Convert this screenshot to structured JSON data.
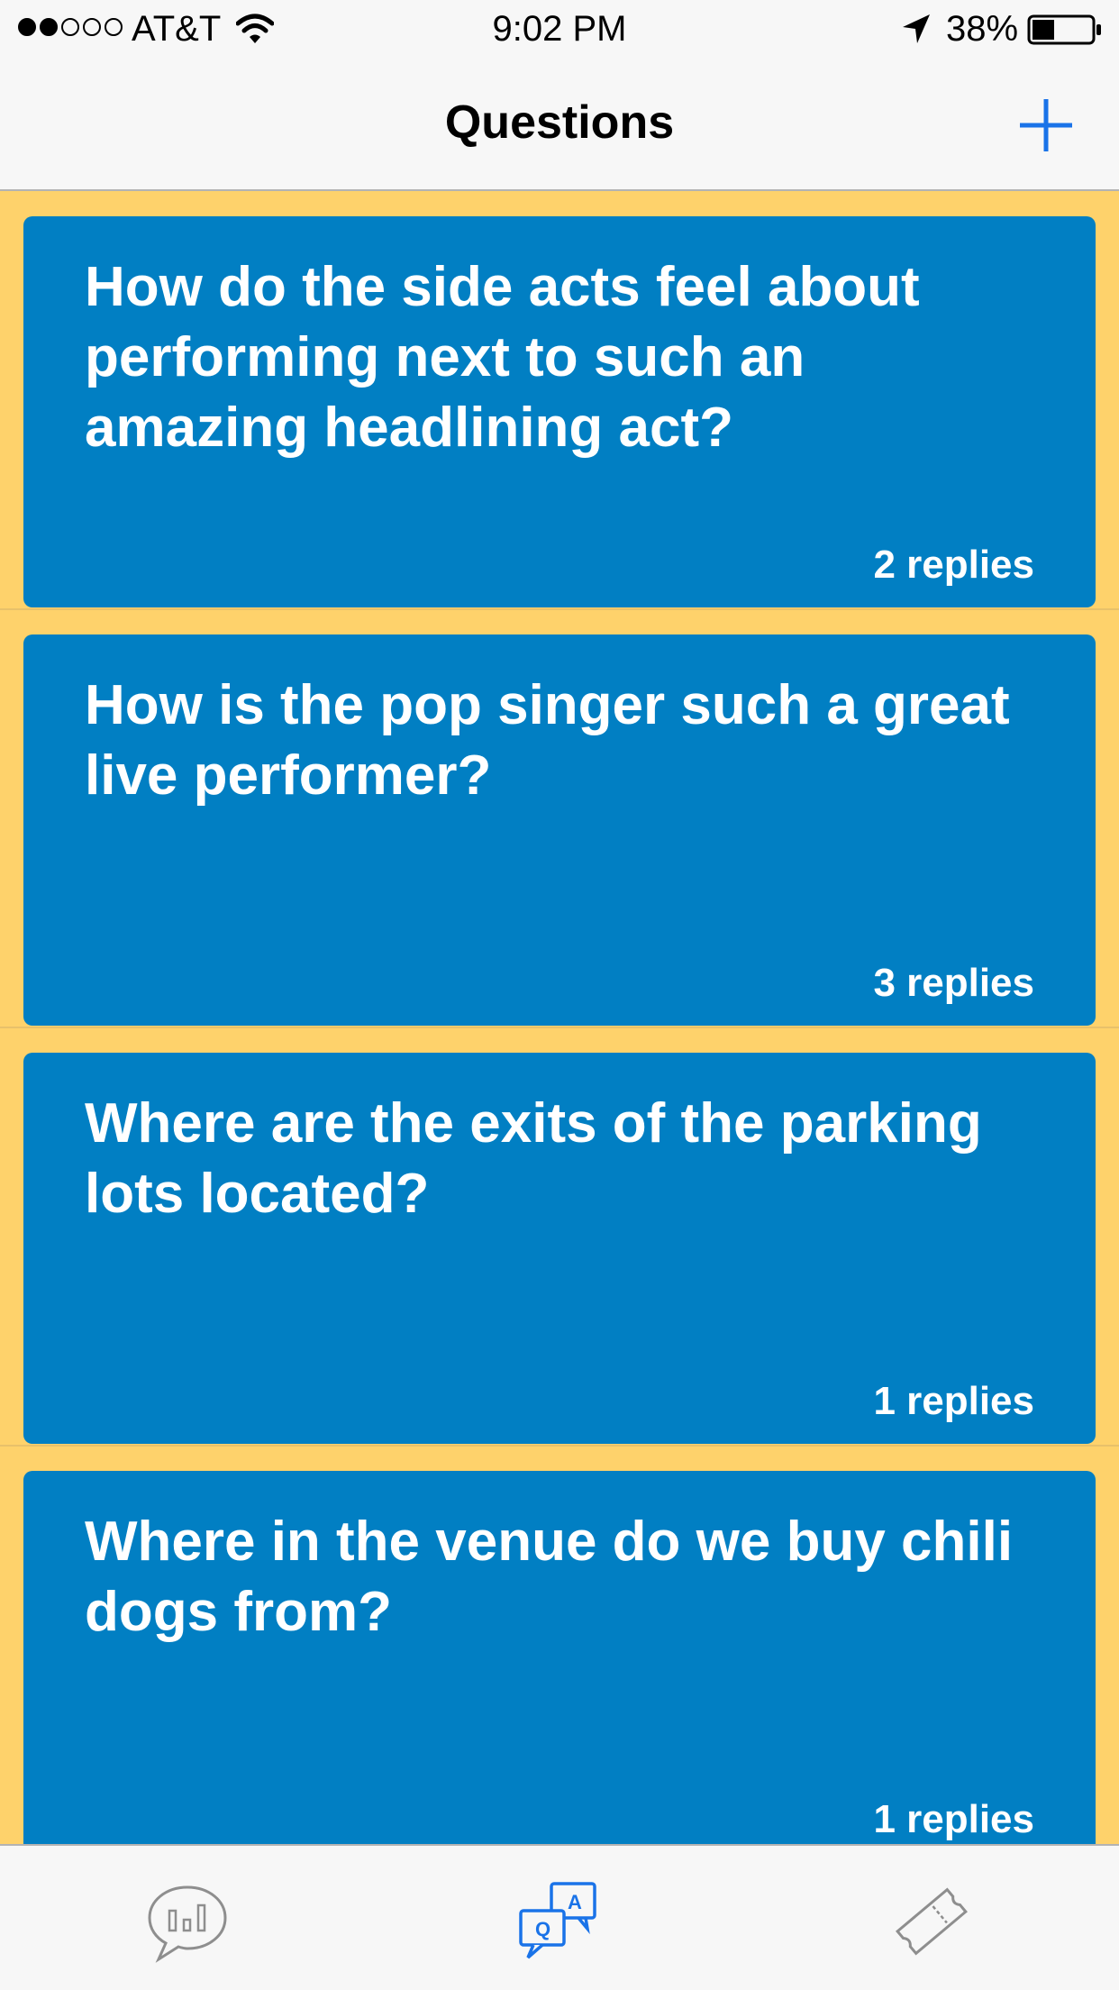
{
  "status_bar": {
    "carrier": "AT&T",
    "time": "9:02 PM",
    "battery": "38%",
    "battery_level": 0.38,
    "signal_bars_filled": 2,
    "signal_bars_total": 5,
    "icons": [
      "wifi-icon",
      "location-arrow-icon",
      "battery-icon"
    ]
  },
  "nav": {
    "title": "Questions",
    "add_icon": "plus-icon",
    "accent_color": "#1a73e8"
  },
  "questions": [
    {
      "text": "How do the side acts feel about performing next to such an amazing headlining act?",
      "replies": "2 replies"
    },
    {
      "text": "How is the pop singer such a great live performer?",
      "replies": "3 replies"
    },
    {
      "text": "Where are the exits of the parking lots located?",
      "replies": "1 replies"
    },
    {
      "text": "Where in the venue do we buy chili dogs from?",
      "replies": "1 replies"
    }
  ],
  "tab_bar": {
    "tabs": [
      {
        "icon": "chat-bubble-chart-icon",
        "selected": false
      },
      {
        "icon": "qa-bubbles-icon",
        "selected": true
      },
      {
        "icon": "ticket-icon",
        "selected": false
      }
    ]
  },
  "colors": {
    "background": "#fed26b",
    "card": "#017fc3",
    "card_text": "#ffffff",
    "bar_background": "#f7f7f7"
  }
}
